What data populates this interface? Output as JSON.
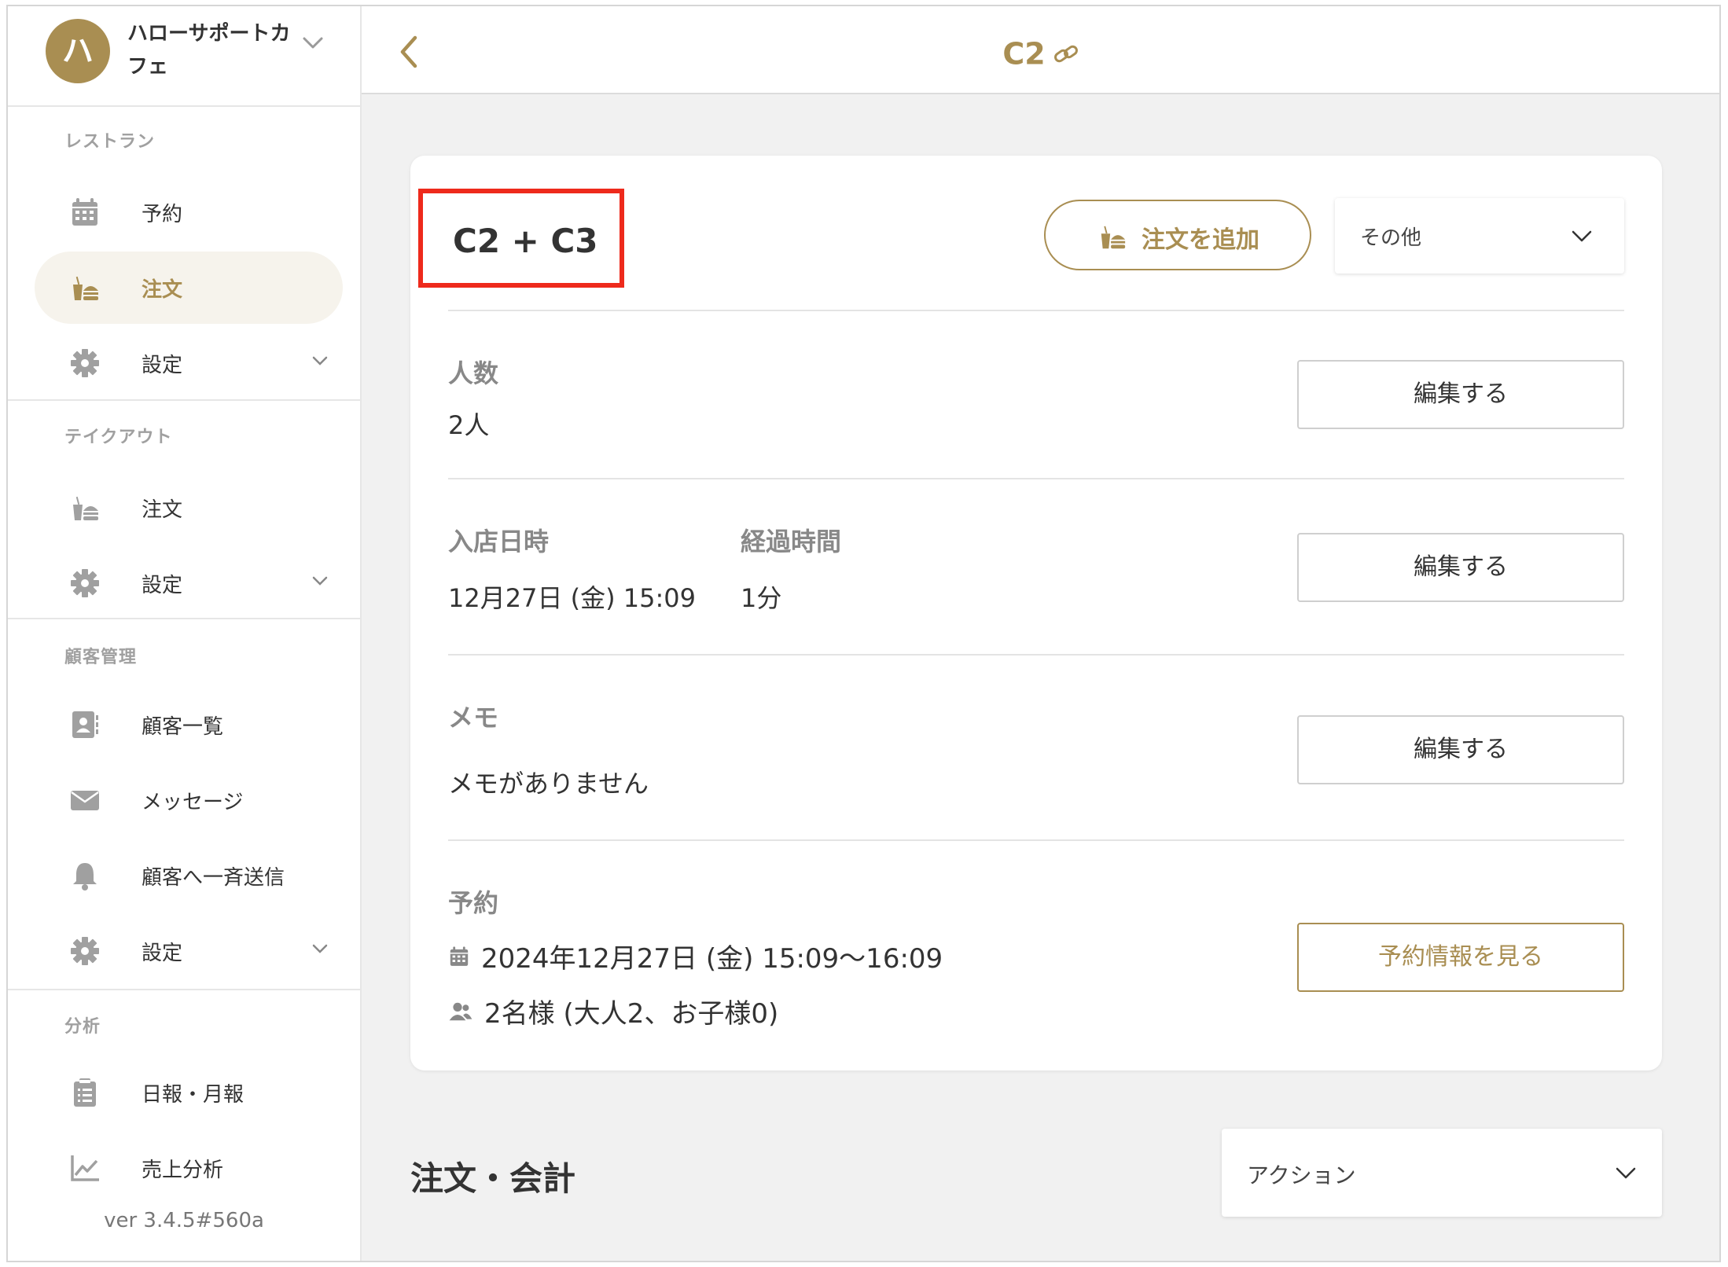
{
  "shop": {
    "initial": "ハ",
    "name_line1": "ハローサポートカ",
    "name_line2": "フェ"
  },
  "sidebar": {
    "sections": [
      {
        "label": "レストラン"
      },
      {
        "label": "テイクアウト"
      },
      {
        "label": "顧客管理"
      },
      {
        "label": "分析"
      }
    ],
    "items": [
      {
        "label": "予約",
        "icon": "calendar-icon"
      },
      {
        "label": "注文",
        "icon": "order-icon",
        "active": true
      },
      {
        "label": "設定",
        "icon": "gear-icon"
      },
      {
        "label": "注文",
        "icon": "order-icon"
      },
      {
        "label": "設定",
        "icon": "gear-icon"
      },
      {
        "label": "顧客一覧",
        "icon": "contact-card-icon"
      },
      {
        "label": "メッセージ",
        "icon": "envelope-icon"
      },
      {
        "label": "顧客へ一斉送信",
        "icon": "bell-icon"
      },
      {
        "label": "設定",
        "icon": "gear-icon"
      },
      {
        "label": "日報・月報",
        "icon": "clipboard-icon"
      },
      {
        "label": "売上分析",
        "icon": "line-chart-icon"
      }
    ],
    "version": "ver 3.4.5#560a"
  },
  "header": {
    "title": "C2"
  },
  "card": {
    "table_name": "C2 + C3",
    "add_order_label": "注文を追加",
    "other_select": "その他",
    "guests": {
      "label": "人数",
      "value": "2人",
      "edit": "編集する"
    },
    "arrival": {
      "label": "入店日時",
      "value": "12月27日 (金) 15:09",
      "elapsed_label": "経過時間",
      "elapsed_value": "1分",
      "edit": "編集する"
    },
    "memo": {
      "label": "メモ",
      "value": "メモがありません",
      "edit": "編集する"
    },
    "reservation": {
      "label": "予約",
      "datetime": "2024年12月27日 (金) 15:09〜16:09",
      "party": "2名様 (大人2、お子様0)",
      "view_button": "予約情報を見る"
    }
  },
  "orders": {
    "heading": "注文・会計",
    "action_select": "アクション"
  },
  "colors": {
    "accent": "#a98e52",
    "highlight_border": "#ee2a1c",
    "active_bg": "#f6f3ec"
  }
}
